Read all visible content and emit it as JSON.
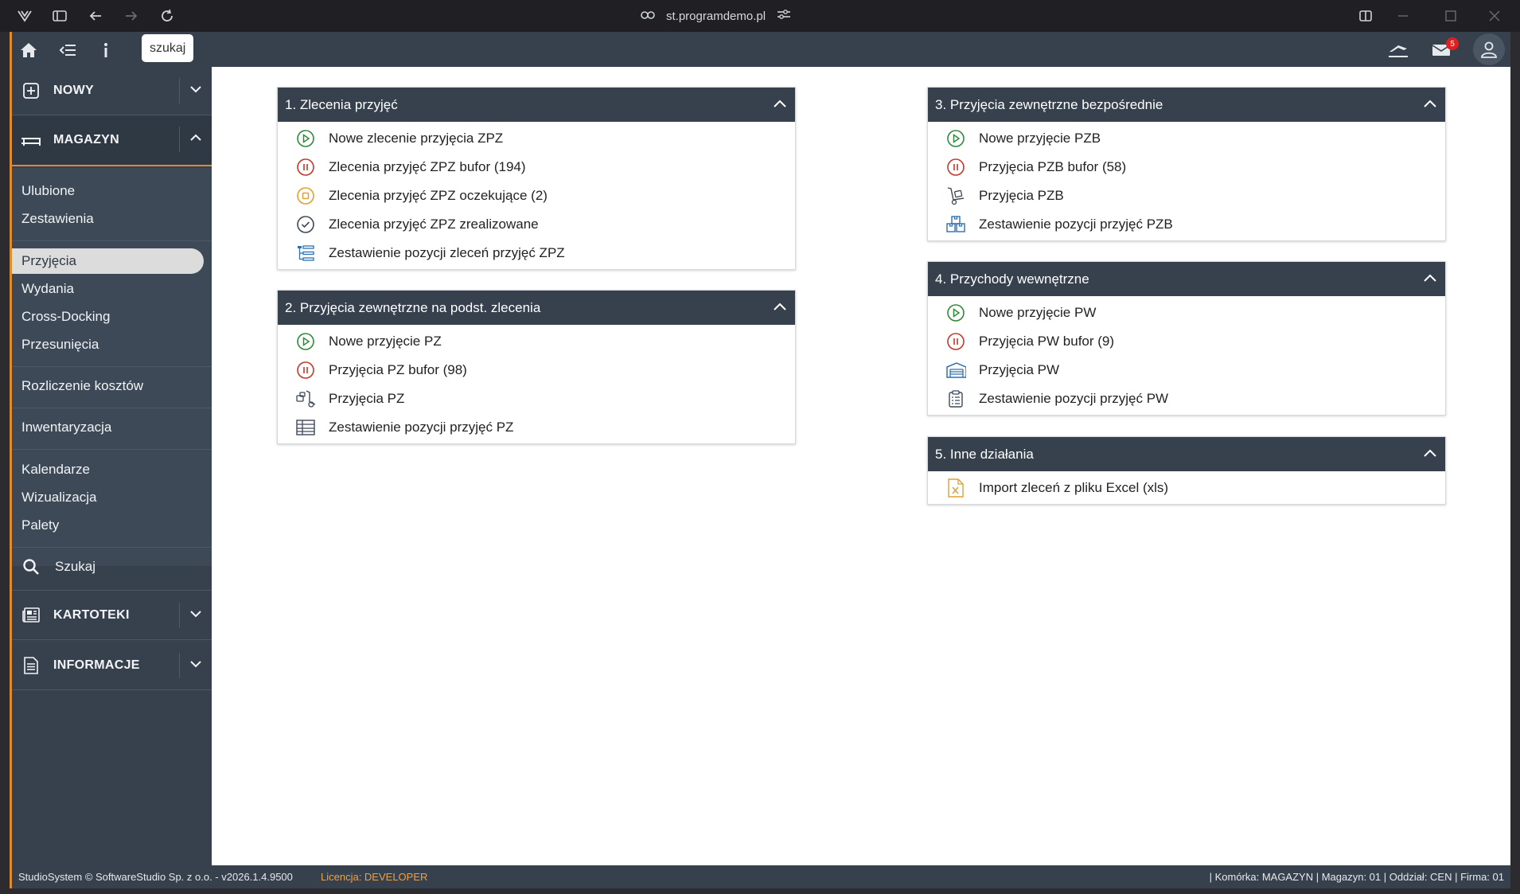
{
  "browser": {
    "url": "st.programdemo.pl"
  },
  "topbar": {
    "search_label": "szukaj",
    "mail_count": "5"
  },
  "sidebar": {
    "nowy": "NOWY",
    "magazyn": "MAGAZYN",
    "fav_items": [
      "Ulubione",
      "Zestawienia"
    ],
    "doc_items": [
      "Przyjęcia",
      "Wydania",
      "Cross-Docking",
      "Przesunięcia"
    ],
    "rozliczenie": "Rozliczenie kosztów",
    "inwentaryzacja": "Inwentaryzacja",
    "tools_items": [
      "Kalendarze",
      "Wizualizacja",
      "Palety"
    ],
    "szukaj": "Szukaj",
    "kartoteki": "KARTOTEKI",
    "informacje": "INFORMACJE"
  },
  "panels": {
    "p1": {
      "title": "1. Zlecenia przyjęć",
      "items": [
        "Nowe zlecenie przyjęcia ZPZ",
        "Zlecenia przyjęć ZPZ bufor (194)",
        "Zlecenia przyjęć ZPZ oczekujące (2)",
        "Zlecenia przyjęć ZPZ zrealizowane",
        "Zestawienie pozycji zleceń przyjęć ZPZ"
      ]
    },
    "p2": {
      "title": "2. Przyjęcia zewnętrzne na podst. zlecenia",
      "items": [
        "Nowe przyjęcie PZ",
        "Przyjęcia PZ bufor (98)",
        "Przyjęcia PZ",
        "Zestawienie pozycji przyjęć PZ"
      ]
    },
    "p3": {
      "title": "3. Przyjęcia zewnętrzne bezpośrednie",
      "items": [
        "Nowe przyjęcie PZB",
        "Przyjęcia PZB bufor (58)",
        "Przyjęcia PZB",
        "Zestawienie pozycji przyjęć PZB"
      ]
    },
    "p4": {
      "title": "4. Przychody wewnętrzne",
      "items": [
        "Nowe przyjęcie PW",
        "Przyjęcia PW bufor (9)",
        "Przyjęcia PW",
        "Zestawienie pozycji przyjęć PW"
      ]
    },
    "p5": {
      "title": "5. Inne działania",
      "items": [
        "Import zleceń z pliku Excel (xls)"
      ]
    }
  },
  "footer": {
    "copyright": "StudioSystem © SoftwareStudio Sp. z o.o. - v2026.1.4.9500",
    "license_label": "Licencja: ",
    "license_value": "DEVELOPER",
    "context": "| Komórka: MAGAZYN | Magazyn: 01 | Oddział: CEN | Firma: 01"
  },
  "colors": {
    "accent": "#e08a2b",
    "sidebar": "#36414d",
    "green": "#2e8b3a",
    "red": "#c0392b",
    "orange": "#e0a030",
    "blue": "#2f6fb3"
  }
}
